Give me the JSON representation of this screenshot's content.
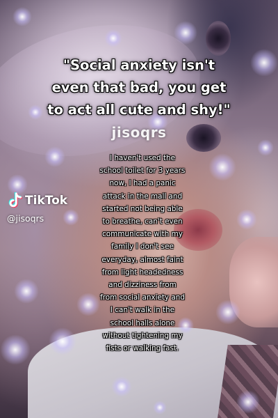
{
  "caption": {
    "lines": [
      "\"Social anxiety isn't",
      "even that bad, you get",
      "to act all cute and shy!\""
    ]
  },
  "overlay_username": "jisoqrs",
  "story": {
    "lines": [
      "I haven't used the",
      "school toilet for 3 years",
      "now, I had a panic",
      "attack in the mall and",
      "started not being able",
      "to breathe, can't even",
      "communicate with my",
      "family I don't see",
      "everyday, almost faint",
      "from light headedness",
      "and dizziness from",
      "from social anxiety and",
      "I can't walk in the",
      "school halls alone",
      "without tightening my",
      "fists or walking fast."
    ]
  },
  "watermark": {
    "brand": "TikTok",
    "handle": "@jisoqrs",
    "icon": "tiktok-logo-icon"
  },
  "colors": {
    "text": "#ffffff",
    "tiktok_cyan": "#25f4ee",
    "tiktok_red": "#fe2c55",
    "sparkle": "#b4aaff"
  }
}
